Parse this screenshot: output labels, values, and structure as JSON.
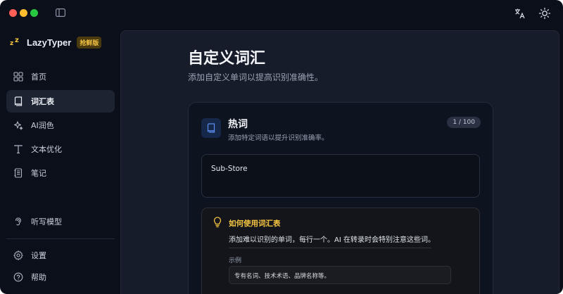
{
  "app": {
    "name": "LazyTyper",
    "badge": "抢鲜版"
  },
  "sidebar": {
    "items": [
      {
        "label": "首页",
        "icon": "grid-icon"
      },
      {
        "label": "词汇表",
        "icon": "book-icon",
        "active": true
      },
      {
        "label": "AI润色",
        "icon": "sparkles-icon"
      },
      {
        "label": "文本优化",
        "icon": "text-t-icon"
      },
      {
        "label": "笔记",
        "icon": "notebook-icon"
      },
      {
        "label": "听写模型",
        "icon": "ear-icon"
      },
      {
        "label": "设置",
        "icon": "gear-icon"
      },
      {
        "label": "帮助",
        "icon": "help-circle-icon"
      }
    ]
  },
  "main": {
    "title": "自定义词汇",
    "subtitle": "添加自定义单词以提高识别准确性。"
  },
  "hotwords": {
    "title": "热词",
    "description": "添加特定词语以提升识别准确率。",
    "count": "1 / 100",
    "value": "Sub-Store"
  },
  "tip": {
    "title": "如何使用词汇表",
    "text": "添加难以识别的单词，每行一个。AI 在转录时会特别注意这些词。",
    "example_label": "示例",
    "example_text": "专有名词、技术术语、品牌名称等。"
  },
  "colors": {
    "accent": "#f5c542",
    "background": "#0b0f1a",
    "panel": "#161c29"
  }
}
